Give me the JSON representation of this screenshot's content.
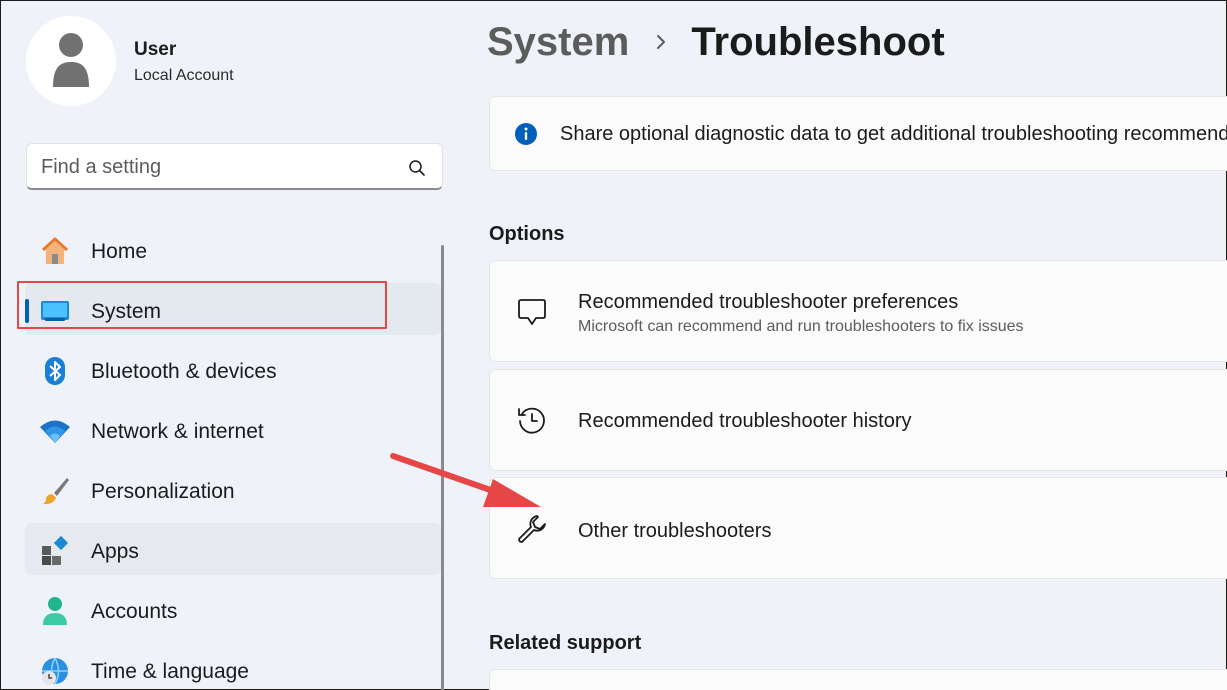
{
  "user": {
    "name": "User",
    "account_type": "Local Account"
  },
  "search": {
    "placeholder": "Find a setting",
    "value": ""
  },
  "sidebar": {
    "items": [
      {
        "label": "Home",
        "icon": "home-icon"
      },
      {
        "label": "System",
        "icon": "system-monitor-icon",
        "selected": true
      },
      {
        "label": "Bluetooth & devices",
        "icon": "bluetooth-icon"
      },
      {
        "label": "Network & internet",
        "icon": "wifi-icon"
      },
      {
        "label": "Personalization",
        "icon": "paintbrush-icon"
      },
      {
        "label": "Apps",
        "icon": "apps-icon"
      },
      {
        "label": "Accounts",
        "icon": "person-icon"
      },
      {
        "label": "Time & language",
        "icon": "globe-clock-icon"
      }
    ]
  },
  "breadcrumb": {
    "parent": "System",
    "current": "Troubleshoot"
  },
  "banner": {
    "text": "Share optional diagnostic data to get additional troubleshooting recommendations",
    "icon": "info-icon"
  },
  "options": {
    "title": "Options",
    "items": [
      {
        "title": "Recommended troubleshooter preferences",
        "subtitle": "Microsoft can recommend and run troubleshooters to fix issues",
        "icon": "chat-bubble-icon"
      },
      {
        "title": "Recommended troubleshooter history",
        "icon": "history-icon"
      },
      {
        "title": "Other troubleshooters",
        "icon": "wrench-icon"
      }
    ]
  },
  "related": {
    "title": "Related support"
  },
  "colors": {
    "accent": "#005fb8",
    "annotation": "#e64646",
    "background": "#eff3f9"
  }
}
